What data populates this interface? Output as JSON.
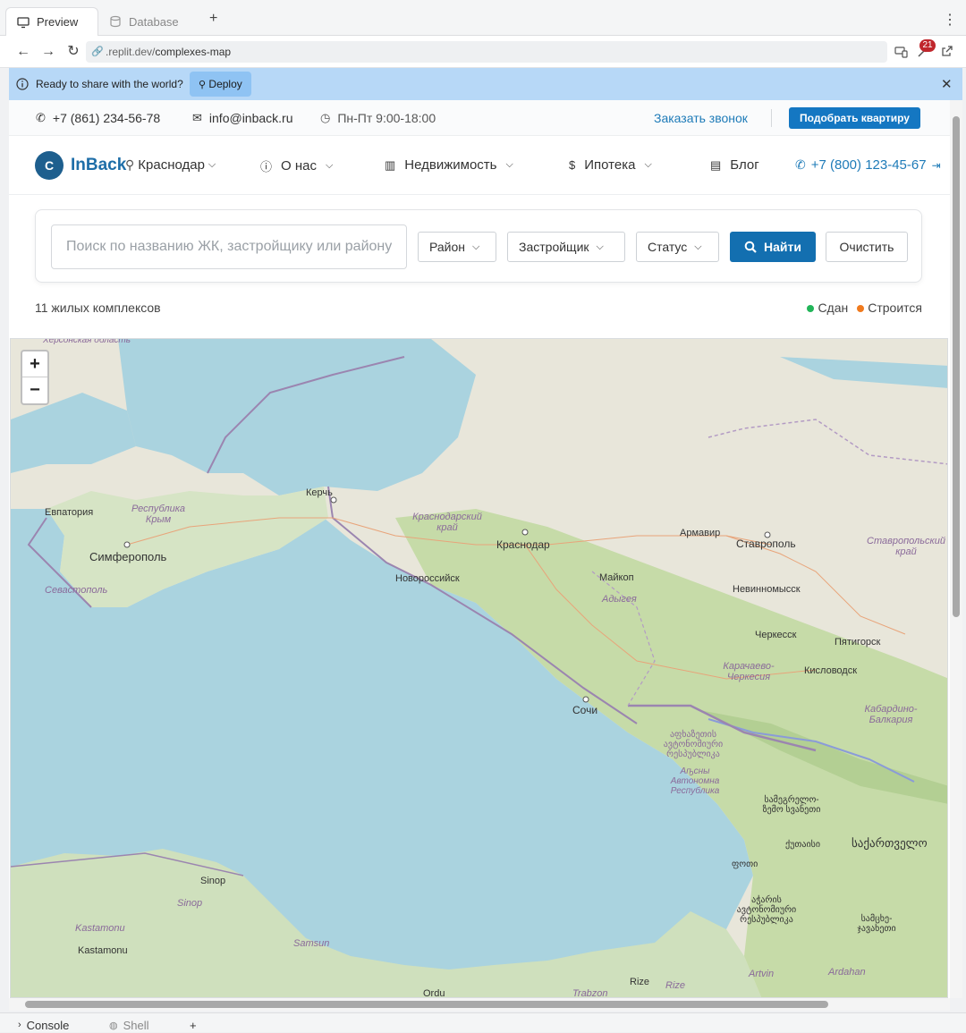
{
  "ide": {
    "tabs": [
      {
        "label": "Preview"
      },
      {
        "label": "Database"
      }
    ],
    "add_tab": "+",
    "menu": "⋮"
  },
  "address": {
    "domain": ".replit.dev/",
    "path": "complexes-map",
    "badge_count": "21"
  },
  "banner": {
    "text": "Ready to share with the world?",
    "deploy_label": "Deploy"
  },
  "topbar": {
    "phone": "+7 (861) 234-56-78",
    "email": "info@inback.ru",
    "hours": "Пн-Пт 9:00-18:00",
    "callback": "Заказать звонок",
    "pick_apartment": "Подобрать квартиру"
  },
  "nav": {
    "logo_letter": "C",
    "logo_text": "InBack",
    "city": "Краснодар",
    "items": [
      {
        "label": "О нас"
      },
      {
        "label": "Недвижимость"
      },
      {
        "label": "Ипотека"
      },
      {
        "label": "Блог"
      }
    ],
    "phone": "+7 (800) 123-45-67"
  },
  "search": {
    "placeholder": "Поиск по названию ЖК, застройщику или району",
    "district": "Район",
    "developer": "Застройщик",
    "status": "Статус",
    "find": "Найти",
    "clear": "Очистить"
  },
  "results": {
    "count": "11 жилых комплексов",
    "legend": [
      {
        "label": "Сдан",
        "color": "#22b559"
      },
      {
        "label": "Строится",
        "color": "#f07a1e"
      }
    ]
  },
  "map": {
    "zoom_in": "+",
    "zoom_out": "−",
    "labels": {
      "kerch": "Керчь",
      "evpatoria": "Евпатория",
      "crimea": "Республика Крым",
      "simferopol": "Симферополь",
      "sevastopol": "Севастополь",
      "krasnodar_region": "Краснодарский край",
      "krasnodar": "Краснодар",
      "novorossiysk": "Новороссийск",
      "armavir": "Армавир",
      "stavropol": "Ставрополь",
      "stavropol_region": "Ставропольский край",
      "maykop": "Майкоп",
      "adygea": "Адыгея",
      "nevinnomyssk": "Невинномысск",
      "cherkessk": "Черкесск",
      "pyatigorsk": "Пятигорск",
      "kislovodsk": "Кисловодск",
      "kchr": "Карачаево-Черкесия",
      "kbr": "Кабардино-Балкария",
      "sochi": "Сочи",
      "abkhazia_ge": "აფხაზეთის ავტონომიური რესპუბლიკა",
      "abkhazia_ru": "Аҧсны Автономна Республика",
      "samegrelo": "სამეგრელო-ზემო სვანეთი",
      "kutaisi": "ქუთაისი",
      "georgia": "საქართველო",
      "poti": "ფოთი",
      "adjara": "აჭარის ავტონომიური რესპუბლიკა",
      "samtskhe": "სამცხე-ჯავახეთი",
      "sinop_city": "Sinop",
      "sinop": "Sinop",
      "kastamonu_region": "Kastamonu",
      "kastamonu": "Kastamonu",
      "samsun": "Samsun",
      "ordu": "Ordu",
      "trabzon": "Trabzon",
      "rize_city": "Rize",
      "rize": "Rize",
      "artvin": "Artvin",
      "ardahan": "Ardahan",
      "kherson": "Херсонская область"
    }
  },
  "bottom": {
    "console": "Console",
    "shell": "Shell",
    "add": "+"
  }
}
